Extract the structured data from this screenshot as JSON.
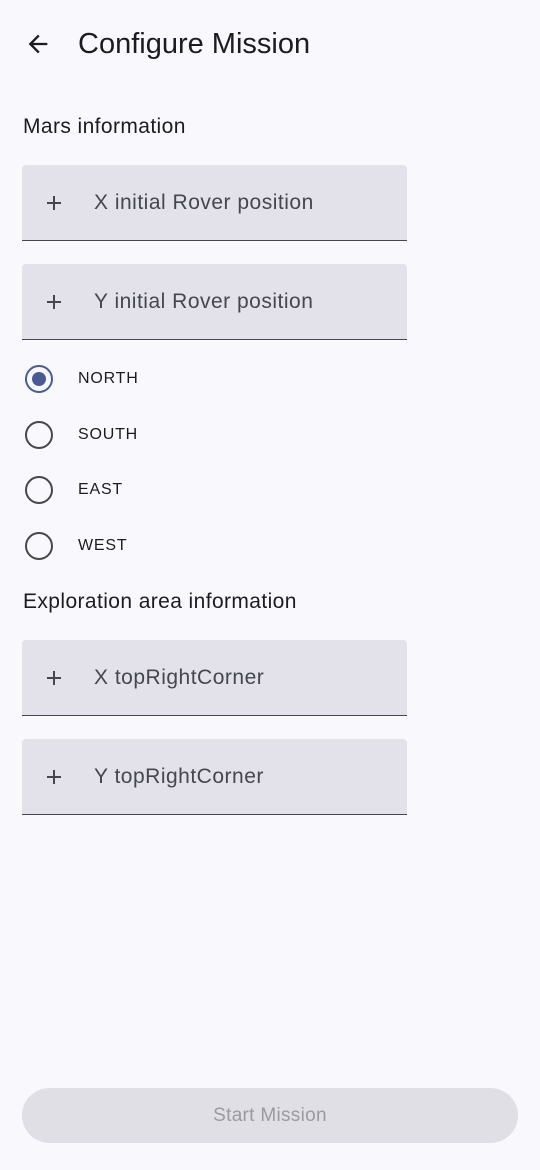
{
  "header": {
    "title": "Configure Mission",
    "back_icon": "arrow-back-icon"
  },
  "mars_section": {
    "label": "Mars information",
    "x_field": {
      "placeholder": "X initial Rover position",
      "value": "",
      "icon": "plus-icon"
    },
    "y_field": {
      "placeholder": "Y initial Rover position",
      "value": "",
      "icon": "plus-icon"
    },
    "directions": [
      {
        "label": "NORTH",
        "selected": true
      },
      {
        "label": "SOUTH",
        "selected": false
      },
      {
        "label": "EAST",
        "selected": false
      },
      {
        "label": "WEST",
        "selected": false
      }
    ]
  },
  "exploration_section": {
    "label": "Exploration area information",
    "x_field": {
      "placeholder": "X topRightCorner",
      "value": "",
      "icon": "plus-icon"
    },
    "y_field": {
      "placeholder": "Y topRightCorner",
      "value": "",
      "icon": "plus-icon"
    }
  },
  "start_button": {
    "label": "Start Mission",
    "enabled": false
  },
  "colors": {
    "background": "#f9f8fd",
    "field_fill": "#e3e2ea",
    "accent": "#4a5b92",
    "disabled_button": "#e0dfe6",
    "disabled_text": "#9a9aa2"
  }
}
